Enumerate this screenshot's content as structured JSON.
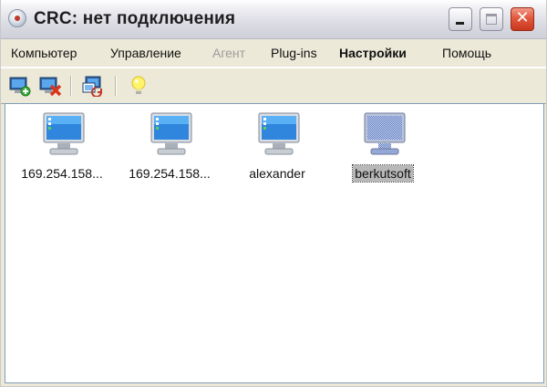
{
  "window": {
    "title": "CRC: нет подключения"
  },
  "menubar": {
    "items": [
      {
        "label": "Компьютер",
        "state": "normal"
      },
      {
        "label": "Управление",
        "state": "normal"
      },
      {
        "label": "Агент",
        "state": "disabled"
      },
      {
        "label": "Plug-ins",
        "state": "normal"
      },
      {
        "label": "Настройки",
        "state": "bold"
      },
      {
        "label": "Помощь",
        "state": "normal"
      }
    ]
  },
  "toolbar": {
    "buttons": [
      {
        "icon": "connect-computer-icon"
      },
      {
        "icon": "disconnect-computer-icon"
      },
      {
        "icon": "refresh-computers-icon"
      },
      {
        "icon": "lightbulb-icon"
      }
    ]
  },
  "computers": [
    {
      "label": "169.254.158...",
      "icon": "monitor-icon",
      "selected": false,
      "offline": false
    },
    {
      "label": "169.254.158...",
      "icon": "monitor-icon",
      "selected": false,
      "offline": false
    },
    {
      "label": "alexander",
      "icon": "monitor-icon",
      "selected": false,
      "offline": false
    },
    {
      "label": "berkutsoft",
      "icon": "monitor-offline-icon",
      "selected": true,
      "offline": true
    }
  ],
  "colors": {
    "accent_close": "#e2583e",
    "selection": "#b8b8b8",
    "screen_online": "#3a8ee0",
    "screen_offline": "#6f88c8"
  }
}
